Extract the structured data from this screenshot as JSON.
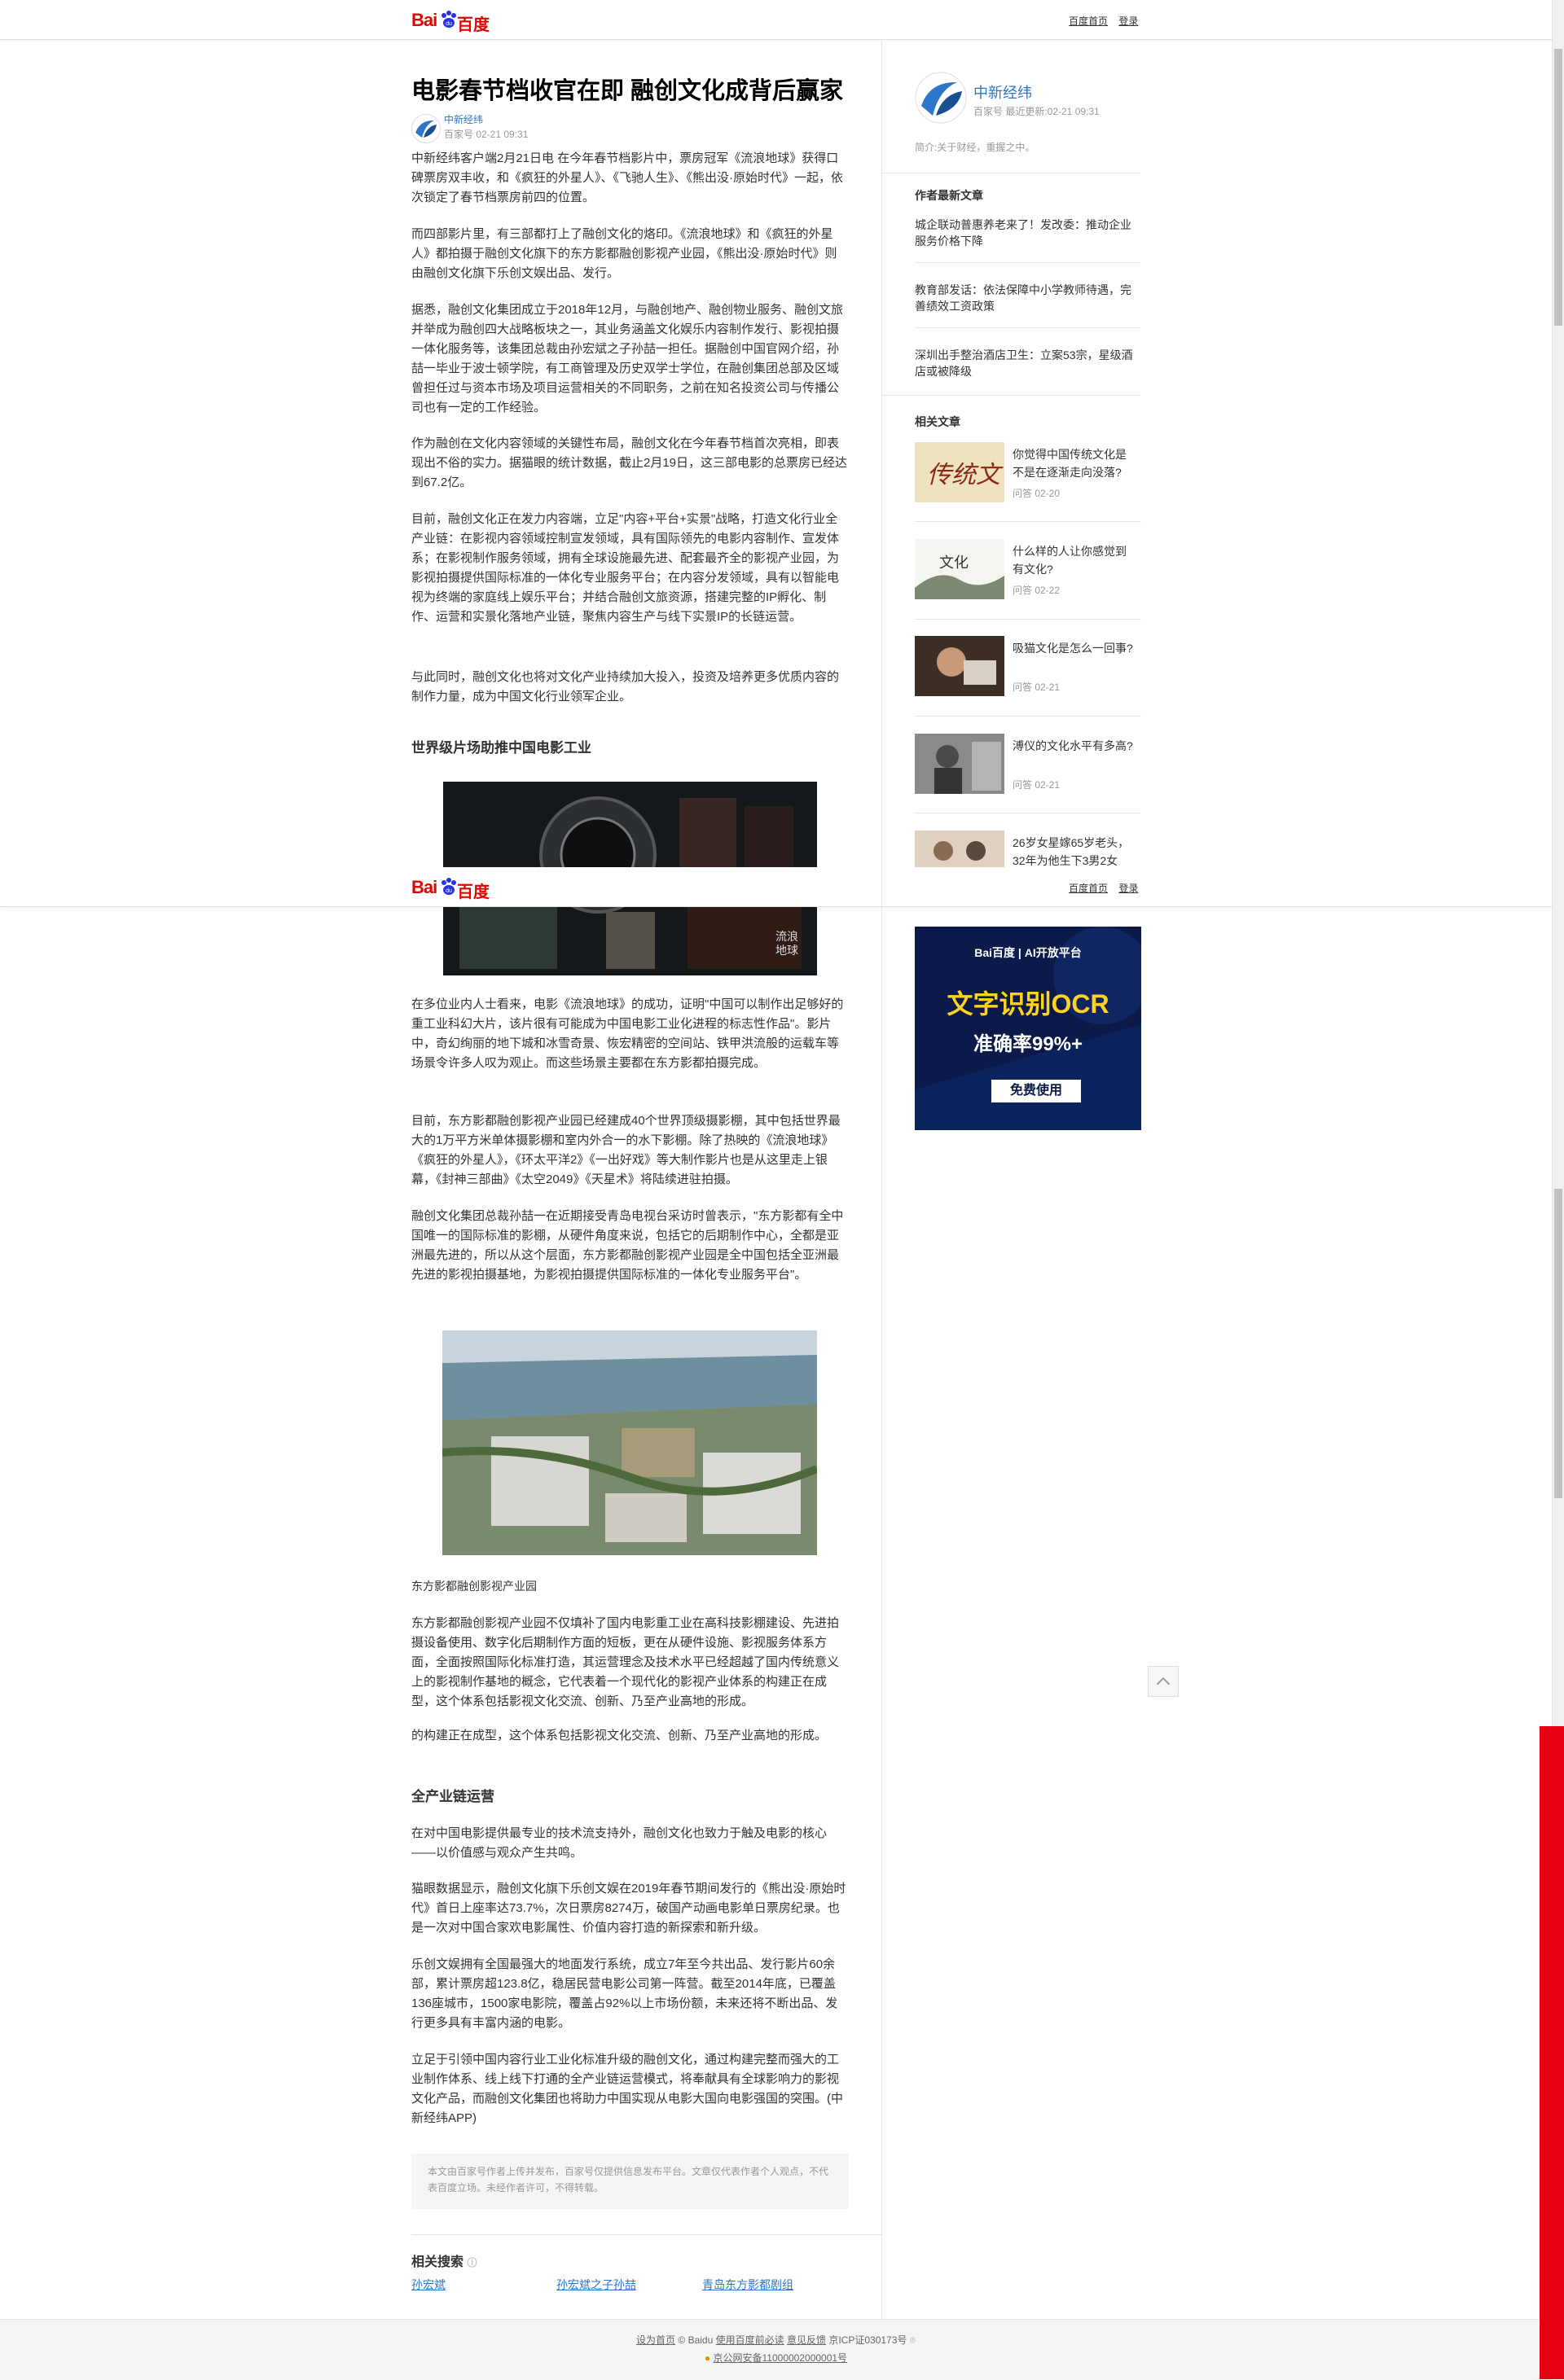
{
  "header": {
    "logo_bai": "Bai",
    "logo_du": "百度",
    "links": [
      "百度首页",
      "登录"
    ]
  },
  "article": {
    "title": "电影春节档收官在即 融创文化成背后赢家",
    "author": "中新经纬",
    "meta": "百家号 02-21 09:31",
    "paragraphs": [
      "中新经纬客户端2月21日电 在今年春节档影片中，票房冠军《流浪地球》获得口碑票房双丰收，和《疯狂的外星人》、《飞驰人生》、《熊出没·原始时代》一起，依次锁定了春节档票房前四的位置。",
      "而四部影片里，有三部都打上了融创文化的烙印。《流浪地球》和《疯狂的外星人》都拍摄于融创文化旗下的东方影都融创影视产业园，《熊出没·原始时代》则由融创文化旗下乐创文娱出品、发行。",
      "据悉，融创文化集团成立于2018年12月，与融创地产、融创物业服务、融创文旅并举成为融创四大战略板块之一，其业务涵盖文化娱乐内容制作发行、影视拍摄一体化服务等，该集团总裁由孙宏斌之子孙喆一担任。据融创中国官网介绍，孙喆一毕业于波士顿学院，有工商管理及历史双学士学位，在融创集团总部及区域曾担任过与资本市场及项目运营相关的不同职务，之前在知名投资公司与传播公司也有一定的工作经验。",
      "作为融创在文化内容领域的关键性布局，融创文化在今年春节档首次亮相，即表现出不俗的实力。据猫眼的统计数据，截止2月19日，这三部电影的总票房已经达到67.2亿。",
      "目前，融创文化正在发力内容端，立足\"内容+平台+实景\"战略，打造文化行业全产业链：在影视内容领域控制宣发领域，具有国际领先的电影内容制作、宣发体系；在影视制作服务领域，拥有全球设施最先进、配套最齐全的影视产业园，为影视拍摄提供国际标准的一体化专业服务平台；在内容分发领域，具有以智能电视为终端的家庭线上娱乐平台；并结合融创文旅资源，搭建完整的IP孵化、制作、运营和实景化落地产业链，聚焦内容生产与线下实景IP的长链运营。",
      "与此同时，融创文化也将对文化产业持续加大投入，投资及培养更多优质内容的制作力量，成为中国文化行业领军企业。"
    ],
    "section1": "世界级片场助推中国电影工业",
    "paragraphs2": [
      "在多位业内人士看来，电影《流浪地球》的成功，证明\"中国可以制作出足够好的重工业科幻大片，该片很有可能成为中国电影工业化进程的标志性作品\"。影片中，奇幻绚丽的地下城和冰雪奇景、恢宏精密的空间站、铁甲洪流般的运载车等场景令许多人叹为观止。而这些场景主要都在东方影都拍摄完成。",
      "目前，东方影都融创影视产业园已经建成40个世界顶级摄影棚，其中包括世界最大的1万平方米单体摄影棚和室内外合一的水下影棚。除了热映的《流浪地球》《疯狂的外星人》，《环太平洋2》《一出好戏》等大制作影片也是从这里走上银幕，《封神三部曲》《太空2049》《天星术》将陆续进驻拍摄。",
      "融创文化集团总裁孙喆一在近期接受青岛电视台采访时曾表示，\"东方影都有全中国唯一的国际标准的影棚，从硬件角度来说，包括它的后期制作中心，全都是亚洲最先进的，所以从这个层面，东方影都融创影视产业园是全中国包括全亚洲最先进的影视拍摄基地，为影视拍摄提供国际标准的一体化专业服务平台\"。"
    ],
    "caption": "东方影都融创影视产业园",
    "paragraphs3": [
      "东方影都融创影视产业园不仅填补了国内电影重工业在高科技影棚建设、先进拍摄设备使用、数字化后期制作方面的短板，更在从硬件设施、影视服务体系方面，全面按照国际化标准打造，其运营理念及技术水平已经超越了国内传统意义上的影视制作基地的概念，它代表着一个现代化的影视产业体系的构建正在成型，这个体系包括影视文化交流、创新、乃至产业高地的形成。",
      "的构建正在成型，这个体系包括影视文化交流、创新、乃至产业高地的形成。"
    ],
    "section2": "全产业链运营",
    "paragraphs4": [
      "在对中国电影提供最专业的技术流支持外，融创文化也致力于触及电影的核心——以价值感与观众产生共鸣。",
      "猫眼数据显示，融创文化旗下乐创文娱在2019年春节期间发行的《熊出没·原始时代》首日上座率达73.7%，次日票房8274万，破国产动画电影单日票房纪录。也是一次对中国合家欢电影属性、价值内容打造的新探索和新升级。",
      "乐创文娱拥有全国最强大的地面发行系统，成立7年至今共出品、发行影片60余部，累计票房超123.8亿，稳居民营电影公司第一阵营。截至2014年底，已覆盖136座城市，1500家电影院，覆盖占92%以上市场份额，未来还将不断出品、发行更多具有丰富内涵的电影。",
      "立足于引领中国内容行业工业化标准升级的融创文化，通过构建完整而强大的工业制作体系、线上线下打通的全产业链运营模式，将奉献具有全球影响力的影视文化产品，而融创文化集团也将助力中国实现从电影大国向电影强国的突围。(中新经纬APP)"
    ],
    "disclaimer": "本文由百家号作者上传并发布，百家号仅提供信息发布平台。文章仅代表作者个人观点，不代表百度立场。未经作者许可，不得转载。",
    "related_search_title": "相关搜索",
    "related_search": [
      "孙宏斌",
      "孙宏斌之子孙喆",
      "青岛东方影都剧组"
    ]
  },
  "sidebar": {
    "author_name": "中新经纬",
    "author_meta": "百家号   最近更新:02-21 09:31",
    "author_desc": "简介:关于财经，重握之中。",
    "latest_title": "作者最新文章",
    "latest": [
      "城企联动普惠养老来了！发改委：推动企业服务价格下降",
      "教育部发话：依法保障中小学教师待遇，完善绩效工资政策",
      "深圳出手整治酒店卫生：立案53宗，星级酒店或被降级"
    ],
    "related_title": "相关文章",
    "related": [
      {
        "title": "你觉得中国传统文化是不是在逐渐走向没落?",
        "meta": "问答   02-20"
      },
      {
        "title": "什么样的人让你感觉到有文化?",
        "meta": "问答   02-22"
      },
      {
        "title": "吸猫文化是怎么一回事?",
        "meta": "问答   02-21"
      },
      {
        "title": "溥仪的文化水平有多高?",
        "meta": "问答   02-21"
      },
      {
        "title": "26岁女星嫁65岁老头，32年为他生下3男2女",
        "meta": ""
      }
    ],
    "ad": {
      "brand": "Bai百度 | AI开放平台",
      "line1": "文字识别OCR",
      "line2": "准确率99%+",
      "button": "免费使用"
    }
  },
  "footer": {
    "line1": [
      "设为首页",
      "© Baidu",
      "使用百度前必读",
      "意见反馈",
      "京ICP证030173号"
    ],
    "line2": "京公网安备11000002000001号"
  },
  "colors": {
    "brand_red": "#e10602",
    "link_blue": "#2d76c9",
    "right_red_bar": "#e60012"
  }
}
